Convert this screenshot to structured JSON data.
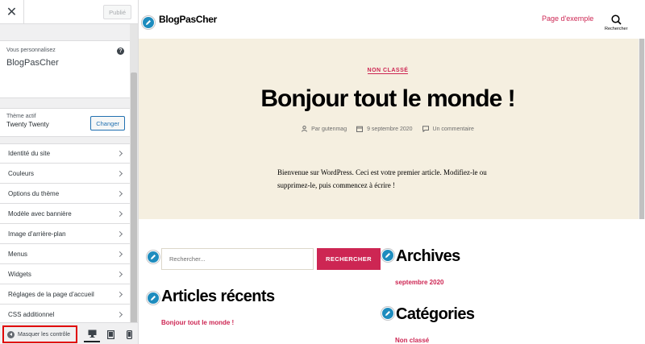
{
  "sidebar": {
    "publish_label": "Publié",
    "customizing_label": "Vous personnalisez",
    "site_name": "BlogPasCher",
    "active_theme_label": "Thème actif",
    "theme_name": "Twenty Twenty",
    "change_label": "Changer",
    "items": [
      {
        "label": "Identité du site"
      },
      {
        "label": "Couleurs"
      },
      {
        "label": "Options du thème"
      },
      {
        "label": "Modèle avec bannière"
      },
      {
        "label": "Image d’arrière-plan"
      },
      {
        "label": "Menus"
      },
      {
        "label": "Widgets"
      },
      {
        "label": "Réglages de la page d’accueil"
      },
      {
        "label": "CSS additionnel"
      }
    ],
    "hide_controls_label": "Masquer les contrôle"
  },
  "preview": {
    "site_title": "BlogPasCher",
    "nav_link": "Page d'exemple",
    "search_label": "Rechercher",
    "post": {
      "category": "NON CLASSÉ",
      "title": "Bonjour tout le monde !",
      "author": "Par gutenmag",
      "date": "9 septembre 2020",
      "comments": "Un commentaire",
      "excerpt": "Bienvenue sur WordPress. Ceci est votre premier article. Modifiez-le ou supprimez-le, puis commencez à écrire !"
    },
    "widgets": {
      "search_placeholder": "Rechercher...",
      "search_button": "RECHERCHER",
      "recent_title": "Articles récents",
      "recent_item": "Bonjour tout le monde !",
      "archives_title": "Archives",
      "archives_item": "septembre 2020",
      "categories_title": "Catégories",
      "categories_item": "Non classé"
    }
  },
  "colors": {
    "accent": "#cd2653",
    "hero_background": "#f5efe0",
    "edit_shortcut": "#1e8cbe",
    "highlight_box": "#e00000"
  },
  "icons": [
    "close-icon",
    "help-icon",
    "chevron-right-icon",
    "hide-controls-icon",
    "desktop-icon",
    "tablet-icon",
    "mobile-icon",
    "pencil-icon",
    "search-icon",
    "user-icon",
    "calendar-icon",
    "comment-icon"
  ]
}
